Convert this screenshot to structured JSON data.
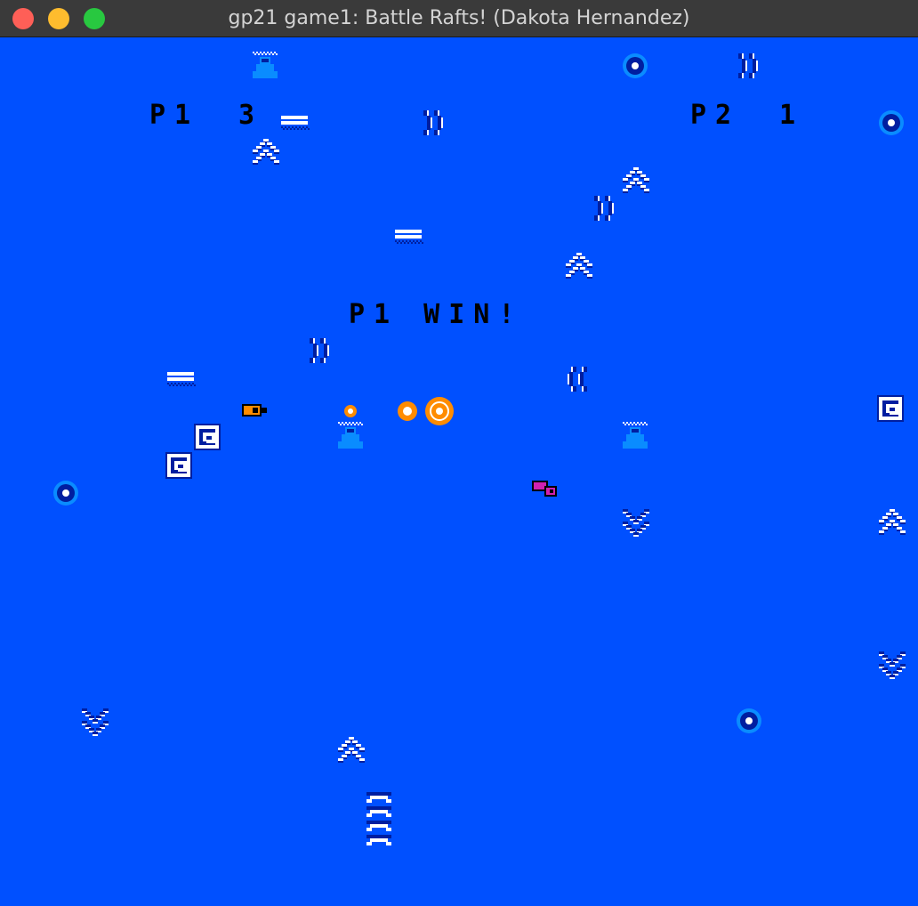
{
  "window": {
    "title": "gp21 game1: Battle Rafts! (Dakota Hernandez)",
    "traffic_lights": {
      "close": "#fe5f57",
      "minimize": "#febc2e",
      "zoom": "#28c840"
    }
  },
  "hud": {
    "p1_label": "P1",
    "p1_score": "3",
    "p2_label": "P2",
    "p2_score": "1",
    "message": "P1 WIN!"
  },
  "colors": {
    "water": "#0050ff",
    "wave_dark": "#001ea0",
    "wave_light": "#ffffff",
    "buoy_ring": "#0a8cff",
    "player1": "#ff8c00",
    "player2": "#d020b0",
    "hud_text": "#000000"
  },
  "entities": {
    "player1_raft": {
      "icon": "orange-raft-icon"
    },
    "player2_raft": {
      "icon": "magenta-raft-icon"
    },
    "cannonballs": {
      "icon": "orange-cannonball-icon"
    }
  }
}
